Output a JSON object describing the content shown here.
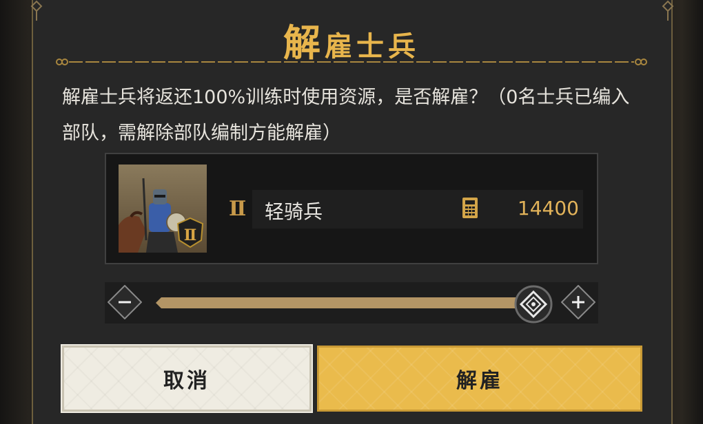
{
  "dialog": {
    "title_first": "解",
    "title_rest": "雇士兵",
    "message": "解雇士兵将返还100%训练时使用资源，是否解雇？（0名士兵已编入部队，需解除部队编制方能解雇）"
  },
  "unit": {
    "tier_numeral": "Ⅱ",
    "name": "轻骑兵",
    "count": "14400",
    "portrait": "armored-knight-on-horse",
    "count_icon": "calculator-icon"
  },
  "slider": {
    "level": 1.0
  },
  "buttons": {
    "cancel": "取消",
    "confirm": "解雇"
  },
  "colors": {
    "accent": "#e8b54c",
    "panel": "#272727",
    "confirm": "#eabb4c",
    "cancel": "#efece2"
  }
}
